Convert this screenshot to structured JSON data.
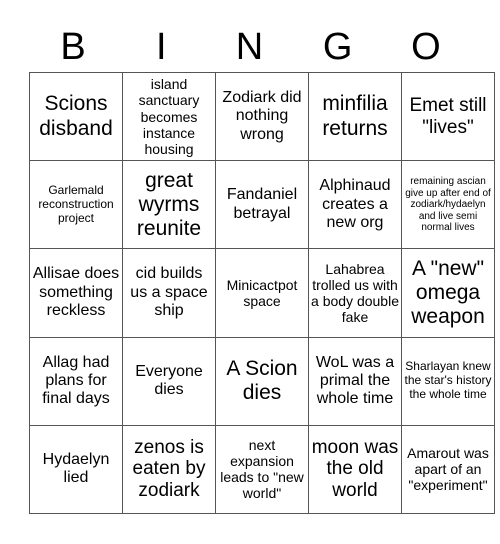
{
  "header": {
    "letters": [
      "B",
      "I",
      "N",
      "G",
      "O"
    ]
  },
  "board": {
    "rows": [
      [
        "Scions disband",
        "island sanctuary becomes instance housing",
        "Zodiark did nothing wrong",
        "minfilia returns",
        "Emet still \"lives\""
      ],
      [
        "Garlemald reconstruction project",
        "great wyrms reunite",
        "Fandaniel betrayal",
        "Alphinaud creates a new org",
        "remaining ascian give up after end of zodiark/hydaelyn and live semi normal lives"
      ],
      [
        "Allisae does something reckless",
        "cid builds us a space ship",
        "Minicactpot space",
        "Lahabrea trolled us with a body double fake",
        "A \"new\" omega weapon"
      ],
      [
        "Allag had plans for final days",
        "Everyone dies",
        "A Scion dies",
        "WoL was a primal the whole time",
        "Sharlayan knew the star's history the whole time"
      ],
      [
        "Hydaelyn lied",
        "zenos is eaten by zodiark",
        "next expansion leads to \"new world\"",
        "moon was the old world",
        "Amarout was apart of an \"experiment\""
      ]
    ]
  }
}
